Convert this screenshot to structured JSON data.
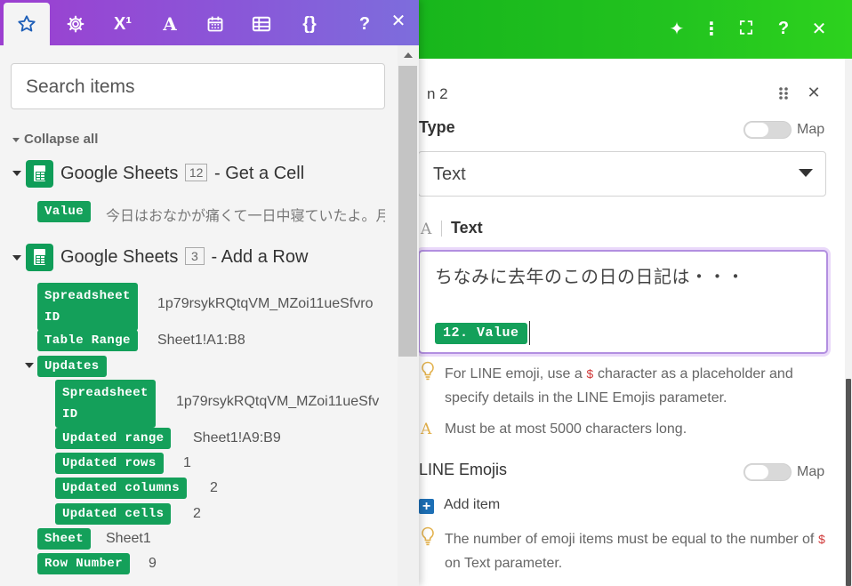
{
  "left": {
    "toolbar": {
      "tabs": [
        {
          "name": "favorites",
          "icon": "star-icon",
          "glyph": "☆"
        },
        {
          "name": "settings",
          "icon": "gear-icon",
          "glyph": "⚙"
        },
        {
          "name": "math",
          "icon": "superscript-icon",
          "glyph": "X¹"
        },
        {
          "name": "text",
          "icon": "text-format-icon",
          "glyph": "A"
        },
        {
          "name": "date",
          "icon": "calendar-icon",
          "glyph": "▦"
        },
        {
          "name": "array",
          "icon": "table-icon",
          "glyph": "☷"
        },
        {
          "name": "json",
          "icon": "braces-icon",
          "glyph": "{}"
        },
        {
          "name": "help",
          "icon": "help-icon",
          "glyph": "?"
        }
      ],
      "close_glyph": "✕"
    },
    "search": {
      "placeholder": "Search items"
    },
    "collapse_all": "Collapse all",
    "modules": [
      {
        "name": "Google Sheets",
        "badge": "12",
        "action": "- Get a Cell",
        "fields": [
          {
            "label": "Value",
            "value": "今日はおなかが痛くて一日中寝ていたよ。月"
          }
        ]
      },
      {
        "name": "Google Sheets",
        "badge": "3",
        "action": "- Add a Row",
        "fields": [
          {
            "label_line1": "Spreadsheet",
            "label_line2": "ID",
            "value": "1p79rsykRQtqVM_MZoi11ueSfvro"
          },
          {
            "label": "Table Range",
            "value": "Sheet1!A1:B8"
          },
          {
            "label": "Updates"
          },
          {
            "label_line1": "Spreadsheet",
            "label_line2": "ID",
            "value": "1p79rsykRQtqVM_MZoi11ueSfv"
          },
          {
            "label": "Updated range",
            "value": "Sheet1!A9:B9"
          },
          {
            "label": "Updated rows",
            "value": "1"
          },
          {
            "label": "Updated columns",
            "value": "2"
          },
          {
            "label": "Updated cells",
            "value": "2"
          },
          {
            "label": "Sheet",
            "value": "Sheet1"
          },
          {
            "label": "Row Number",
            "value": "9"
          }
        ]
      }
    ]
  },
  "right": {
    "header_icons": [
      "magic-icon",
      "more-vertical-icon",
      "expand-icon",
      "help-icon",
      "close-icon"
    ],
    "header_glyphs": [
      "✦",
      "⋮",
      "⛶",
      "?",
      "✕"
    ],
    "module_title": "n 2",
    "type": {
      "label": "Type",
      "map_label": "Map",
      "value": "Text"
    },
    "text": {
      "icon_glyph": "A",
      "label": "Text",
      "content": "ちなみに去年のこの日の日記は・・・",
      "pill": "12. Value"
    },
    "hint1": {
      "before": "For LINE emoji, use a ",
      "code": "$",
      "after": " character as a placeholder and specify details in the LINE Emojis parameter."
    },
    "hint2": {
      "glyph": "A",
      "text": "Must be at most 5000 characters long."
    },
    "emojis": {
      "label": "LINE Emojis",
      "map_label": "Map"
    },
    "add_item": {
      "glyph": "+",
      "label": "Add item"
    },
    "hint3": {
      "before": "The number of emoji items must be equal to the number of ",
      "code": "$",
      "after": " on Text parameter."
    },
    "close_glyph": "✕"
  },
  "colors": {
    "left_toolbar": "#8a56d8",
    "right_header": "#22c31f",
    "pill": "#14a05a",
    "editor_focus": "#b28fe0"
  }
}
